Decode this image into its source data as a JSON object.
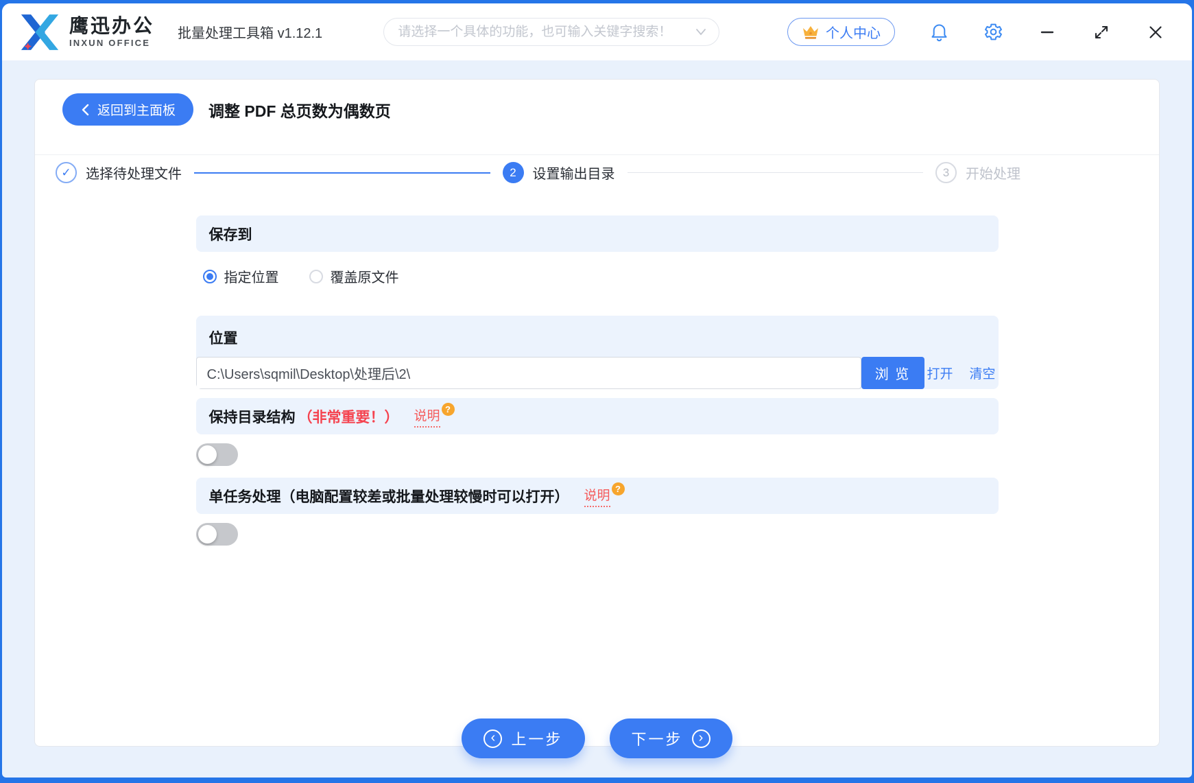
{
  "header": {
    "brand_cn": "鹰迅办公",
    "brand_en": "INXUN OFFICE",
    "app_title": "批量处理工具箱 v1.12.1",
    "search_placeholder": "请选择一个具体的功能，也可输入关键字搜索！",
    "user_center": "个人中心"
  },
  "page": {
    "back": "返回到主面板",
    "title": "调整 PDF 总页数为偶数页",
    "steps": [
      {
        "num": "1",
        "label": "选择待处理文件",
        "status": "done"
      },
      {
        "num": "2",
        "label": "设置输出目录",
        "status": "active"
      },
      {
        "num": "3",
        "label": "开始处理",
        "status": "pending"
      }
    ],
    "save_to": {
      "title": "保存到",
      "option_specify": "指定位置",
      "option_overwrite": "覆盖原文件",
      "selected": "指定位置"
    },
    "location": {
      "title": "位置",
      "path": "C:\\Users\\sqmil\\Desktop\\处理后\\2\\",
      "browse": "浏 览",
      "open": "打开",
      "clear": "清空"
    },
    "keep_structure": {
      "title": "保持目录结构",
      "warning": "（非常重要！）",
      "help": "说明",
      "enabled": false
    },
    "single_task": {
      "title": "单任务处理（电脑配置较差或批量处理较慢时可以打开）",
      "help": "说明",
      "enabled": false
    },
    "prev": "上一步",
    "next": "下一步"
  },
  "colors": {
    "primary": "#3b7cf3",
    "frame": "#2575e8",
    "band": "#ecf3fd",
    "danger": "#f5434f",
    "help_orange": "#f7a52d"
  }
}
